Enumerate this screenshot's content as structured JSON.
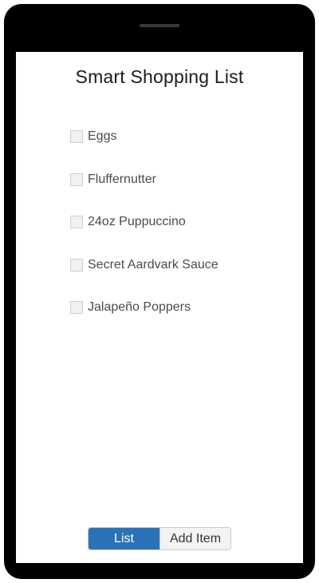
{
  "header": {
    "title": "Smart Shopping List"
  },
  "shopping_list": {
    "items": [
      {
        "label": "Eggs",
        "checked": false
      },
      {
        "label": "Fluffernutter",
        "checked": false
      },
      {
        "label": "24oz Puppuccino",
        "checked": false
      },
      {
        "label": "Secret Aardvark Sauce",
        "checked": false
      },
      {
        "label": "Jalapeño Poppers",
        "checked": false
      }
    ]
  },
  "tabs": {
    "list_label": "List",
    "add_item_label": "Add Item",
    "active": "List"
  },
  "colors": {
    "active_tab": "#2b73b8",
    "frame": "#000000",
    "screen": "#ffffff"
  }
}
